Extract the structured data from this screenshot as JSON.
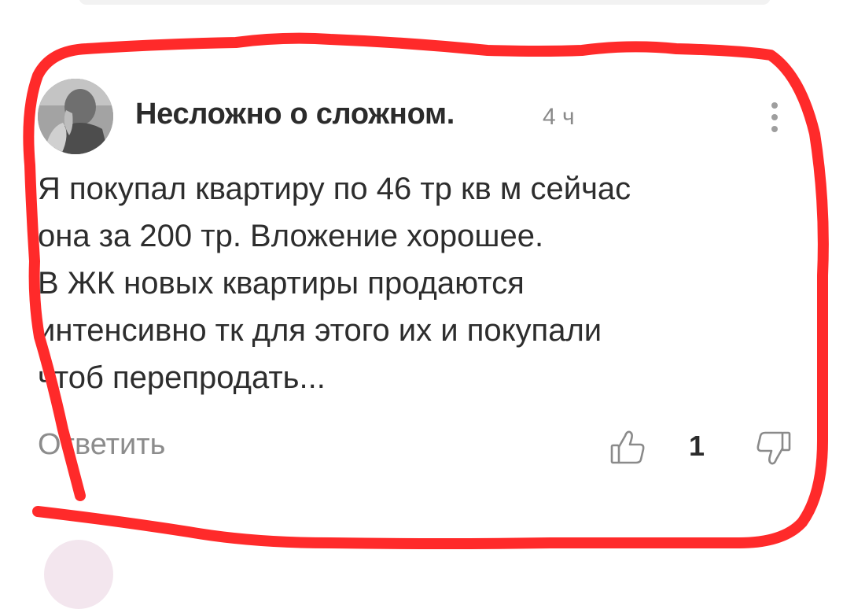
{
  "comment": {
    "author": "Несложно о сложном.",
    "time": "4 ч",
    "text_lines": [
      "Я покупал квартиру по 46 тр кв м сейчас",
      "она за 200 тр. Вложение хорошее.",
      "В ЖК новых квартиры продаются",
      "интенсивно тк для этого их и покупали",
      "чтоб перепродать..."
    ],
    "reply_label": "Ответить",
    "likes": "1"
  },
  "icons": {
    "menu": "more-vertical-icon",
    "like": "thumbs-up-icon",
    "dislike": "thumbs-down-icon"
  },
  "colors": {
    "annotation": "#ff2a2a",
    "author": "#2b2b2b",
    "meta": "#8a8a8a"
  }
}
